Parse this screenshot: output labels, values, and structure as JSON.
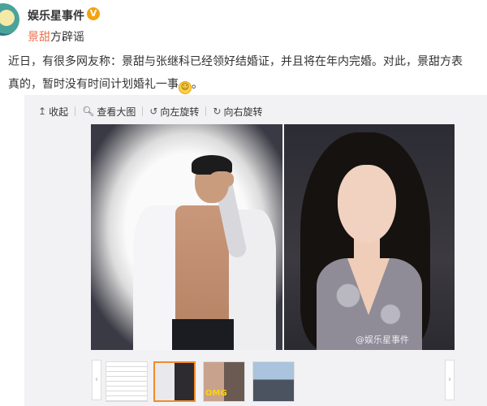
{
  "post": {
    "author": "娱乐星事件",
    "badge": "V",
    "headline_link": "景甜",
    "headline_rest": "方辟谣",
    "body_line1": "近日，有很多网友称：景甜与张继科已经领好结婚证，并且将在年内完婚。对此，景甜方表",
    "body_line2": "真的，暂时没有时间计划婚礼一事",
    "emoji": "smiling-face-emoji"
  },
  "toolbar": {
    "collapse": {
      "icon": "↥",
      "label": "收起"
    },
    "view_large": {
      "icon": "🔍︎",
      "label": "查看大图"
    },
    "rotate_left": {
      "icon": "↺",
      "label": "向左旋转"
    },
    "rotate_right": {
      "icon": "↻",
      "label": "向右旋转"
    }
  },
  "media": {
    "watermark": "@娱乐星事件",
    "thumb_caption": "OMG"
  },
  "colors": {
    "link": "#eb7350",
    "active_thumb_border": "#f28b2a",
    "vip_badge": "#f4a20d"
  }
}
